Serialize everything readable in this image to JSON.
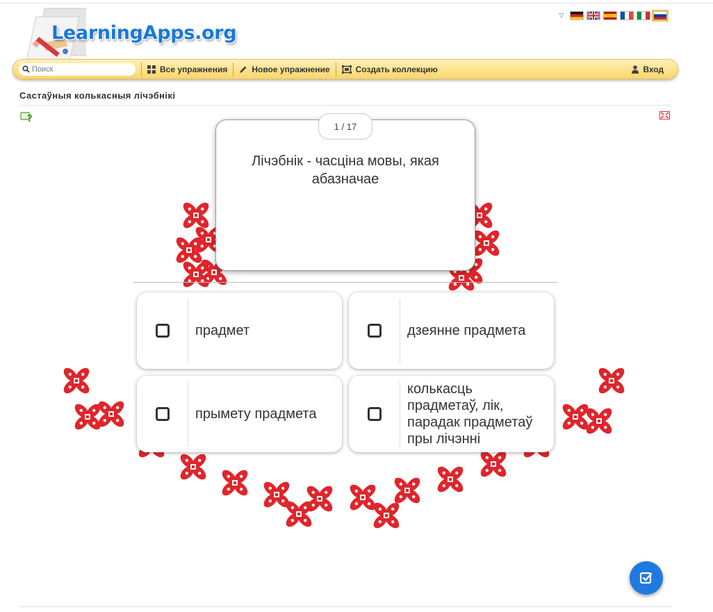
{
  "brand": {
    "logo_text": "LearningApps.org"
  },
  "languages": [
    "Deutsch",
    "English",
    "Español",
    "Français",
    "Italiano",
    "Русский"
  ],
  "navbar": {
    "search_placeholder": "Поиск",
    "all_exercises": "Все упражнения",
    "new_exercise": "Новое упражнение",
    "create_collection": "Создать коллекцию",
    "login": "Вход"
  },
  "page": {
    "title": "Састаўныя колькасныя лічэбнікі"
  },
  "quiz": {
    "counter": "1 / 17",
    "question": "Лічэбнік - часціна мовы, якая абазначае",
    "answers": [
      {
        "label": "прадмет"
      },
      {
        "label": "дзеянне прадмета"
      },
      {
        "label": "прымету прадмета"
      },
      {
        "label": "колькасць прадметаў, лік, парадак прадметаў пры лічэнні"
      }
    ]
  },
  "colors": {
    "accent": "#1f7ae0",
    "ornament": "#e0252b",
    "navbar": "#fbd66a"
  }
}
